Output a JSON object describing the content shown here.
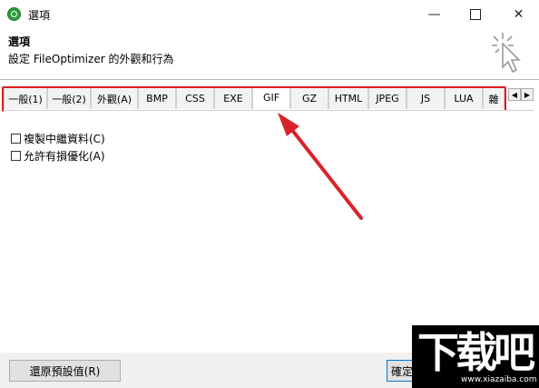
{
  "window": {
    "title": "選項",
    "min_glyph": "—",
    "close_glyph": "✕"
  },
  "header": {
    "title": "選項",
    "subtitle": "設定 FileOptimizer 的外觀和行為"
  },
  "tabs": [
    {
      "label": "一般(1)"
    },
    {
      "label": "一般(2)"
    },
    {
      "label": "外觀(A)"
    },
    {
      "label": "BMP"
    },
    {
      "label": "CSS"
    },
    {
      "label": "EXE"
    },
    {
      "label": "GIF"
    },
    {
      "label": "GZ"
    },
    {
      "label": "HTML"
    },
    {
      "label": "JPEG"
    },
    {
      "label": "JS"
    },
    {
      "label": "LUA"
    },
    {
      "label": "雜"
    }
  ],
  "active_tab": "GIF",
  "tab_scroll": {
    "left": "◀",
    "right": "▶"
  },
  "options": [
    {
      "label": "複製中繼資料(C)",
      "checked": false
    },
    {
      "label": "允許有損優化(A)",
      "checked": false
    }
  ],
  "footer": {
    "reset_label": "還原預設值(R)",
    "ok_label": "確定"
  },
  "watermark": {
    "text": "下载吧",
    "site": "www.xiazaiba.com"
  },
  "colors": {
    "highlight": "#e31b23",
    "tab_bg": "#f2f2f2",
    "footer_bg": "#f0f0f0"
  }
}
